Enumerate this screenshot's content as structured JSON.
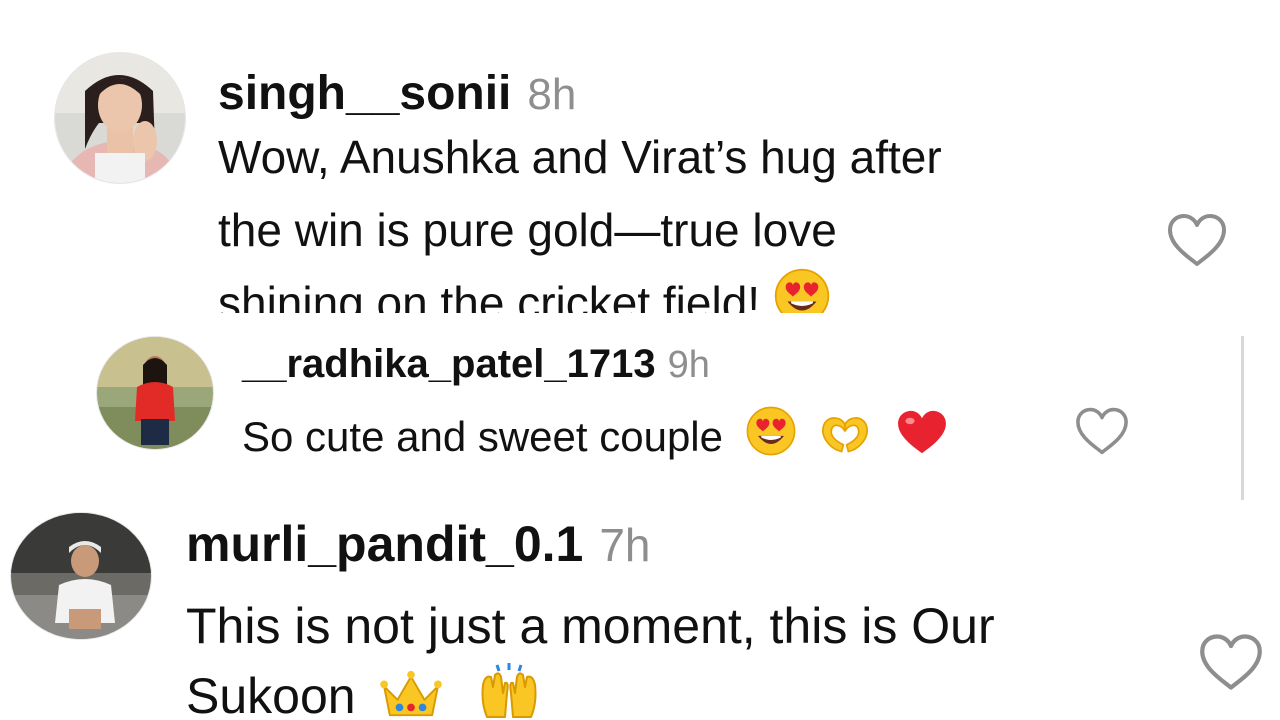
{
  "comments": [
    {
      "username": "singh__sonii",
      "timestamp": "8h",
      "lines": [
        "Wow, Anushka and Virat’s hug after",
        "the win is pure gold—true love",
        "shining on the cricket field!"
      ],
      "trailing_emoji": [
        "smiling-face-with-heart-eyes-icon"
      ]
    },
    {
      "username": "__radhika_patel_1713",
      "timestamp": "9h",
      "lines": [
        "So cute and sweet couple"
      ],
      "trailing_emoji": [
        "smiling-face-with-heart-eyes-icon",
        "heart-hands-icon",
        "red-heart-icon"
      ],
      "is_reply": true
    },
    {
      "username": "murli_pandit_0.1",
      "timestamp": "7h",
      "lines": [
        "This is not just a moment, this is Our",
        "Sukoon"
      ],
      "trailing_emoji": [
        "crown-icon",
        "raising-hands-icon"
      ]
    }
  ],
  "icons": {
    "like": "heart-outline-icon"
  },
  "colors": {
    "text": "#111111",
    "timestamp": "#8e8e8e",
    "like_outline": "#8e8e8e",
    "emoji_yellow": "#f9c623",
    "heart_red": "#e8232f"
  }
}
